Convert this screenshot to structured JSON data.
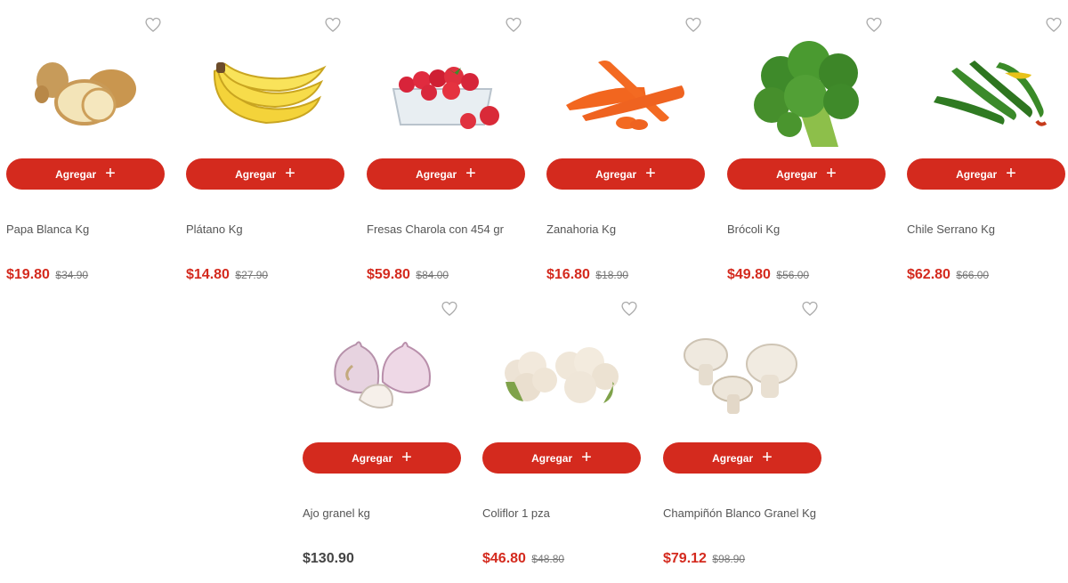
{
  "add_label": "Agregar",
  "colors": {
    "accent": "#d42a1e"
  },
  "products": [
    {
      "name": "Papa Blanca Kg",
      "price": "$19.80",
      "old_price": "$34.90",
      "image": "potato"
    },
    {
      "name": "Plátano Kg",
      "price": "$14.80",
      "old_price": "$27.90",
      "image": "banana"
    },
    {
      "name": "Fresas Charola con 454 gr",
      "price": "$59.80",
      "old_price": "$84.00",
      "image": "strawberries"
    },
    {
      "name": "Zanahoria Kg",
      "price": "$16.80",
      "old_price": "$18.90",
      "image": "carrot"
    },
    {
      "name": "Brócoli Kg",
      "price": "$49.80",
      "old_price": "$56.00",
      "image": "broccoli"
    },
    {
      "name": "Chile Serrano Kg",
      "price": "$62.80",
      "old_price": "$66.00",
      "image": "chili"
    },
    {
      "name": "Ajo granel kg",
      "price": "$130.90",
      "old_price": "",
      "image": "garlic"
    },
    {
      "name": "Coliflor 1 pza",
      "price": "$46.80",
      "old_price": "$48.80",
      "image": "cauliflower"
    },
    {
      "name": "Champiñón Blanco Granel Kg",
      "price": "$79.12",
      "old_price": "$98.90",
      "image": "mushroom"
    }
  ]
}
